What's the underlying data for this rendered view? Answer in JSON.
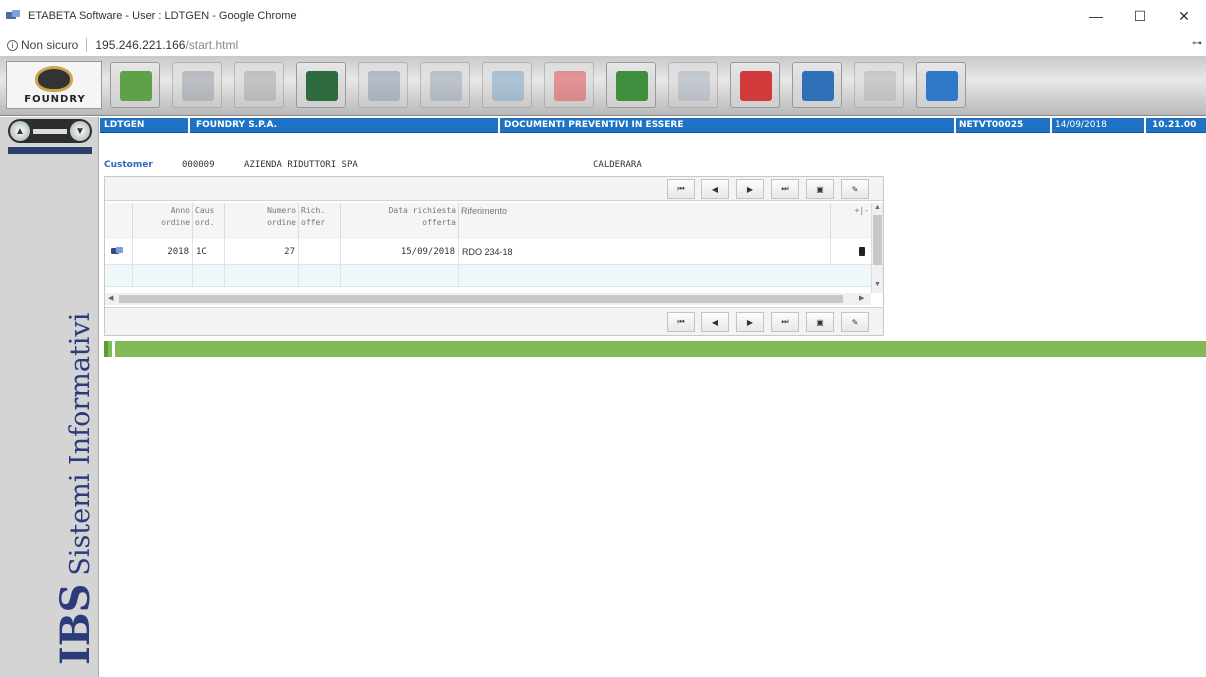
{
  "window": {
    "title": "ETABETA Software - User : LDTGEN - Google Chrome",
    "controls": {
      "minimize": "—",
      "maximize": "☐",
      "close": "✕"
    }
  },
  "address_bar": {
    "security_label": "Non sicuro",
    "host": "195.246.221.166",
    "path": "/start.html"
  },
  "logo": {
    "brand": "FOUNDRY"
  },
  "toolbar_buttons": [
    {
      "icon": "card-hand-icon",
      "color": "#5fa04a",
      "enabled": true
    },
    {
      "icon": "disc-icon",
      "color": "#9aa0a8",
      "enabled": false
    },
    {
      "icon": "box-icon",
      "color": "#a8a8a8",
      "enabled": false
    },
    {
      "icon": "money-icon",
      "color": "#2e6b3e",
      "enabled": true
    },
    {
      "icon": "grid-icon",
      "color": "#8a9cb0",
      "enabled": false
    },
    {
      "icon": "chart-icon",
      "color": "#9aa6b4",
      "enabled": false
    },
    {
      "icon": "globe-icon",
      "color": "#7fa6c8",
      "enabled": false
    },
    {
      "icon": "delete-x-icon",
      "color": "#e05050",
      "enabled": false
    },
    {
      "icon": "excel-icon",
      "color": "#3f8f3f",
      "enabled": true
    },
    {
      "icon": "doc-icon",
      "color": "#a9b3bd",
      "enabled": false
    },
    {
      "icon": "pdf-icon",
      "color": "#d03a3a",
      "enabled": true
    },
    {
      "icon": "refresh-icon",
      "color": "#2f6fb8",
      "enabled": true
    },
    {
      "icon": "print-icon",
      "color": "#b5b5b5",
      "enabled": false
    },
    {
      "icon": "info-icon",
      "color": "#2f78c8",
      "enabled": true
    }
  ],
  "header": {
    "user": "LDTGEN",
    "company": "FOUNDRY S.P.A.",
    "document_title": "DOCUMENTI PREVENTIVI IN ESSERE",
    "program_code": "NETVT00025",
    "date": "14/09/2018",
    "time": "10.21.00"
  },
  "customer": {
    "label": "Customer",
    "code": "000009",
    "name": "AZIENDA RIDUTTORI SPA",
    "city": "CALDERARA"
  },
  "pager": {
    "first": "⏮",
    "prev": "◀",
    "next": "▶",
    "last": "⏭",
    "excel": "▣",
    "edit": "✎"
  },
  "table": {
    "columns": [
      {
        "line1": "Anno",
        "line2": "ordine"
      },
      {
        "line1": "Caus",
        "line2": "ord."
      },
      {
        "line1": "Numero",
        "line2": "ordine"
      },
      {
        "line1": "Rich.",
        "line2": "offer"
      },
      {
        "line1": "Data richiesta",
        "line2": "offerta"
      },
      {
        "line1": "Riferimento",
        "line2": ""
      },
      {
        "line1": "+|-",
        "line2": ""
      }
    ],
    "rows": [
      {
        "anno": "2018",
        "caus": "1C",
        "numero": "27",
        "rich": "",
        "data": "15/09/2018",
        "riferimento": "RDO 234-18"
      }
    ]
  },
  "sidebar": {
    "brand": "IBS",
    "tagline": "Sistemi Informativi"
  }
}
